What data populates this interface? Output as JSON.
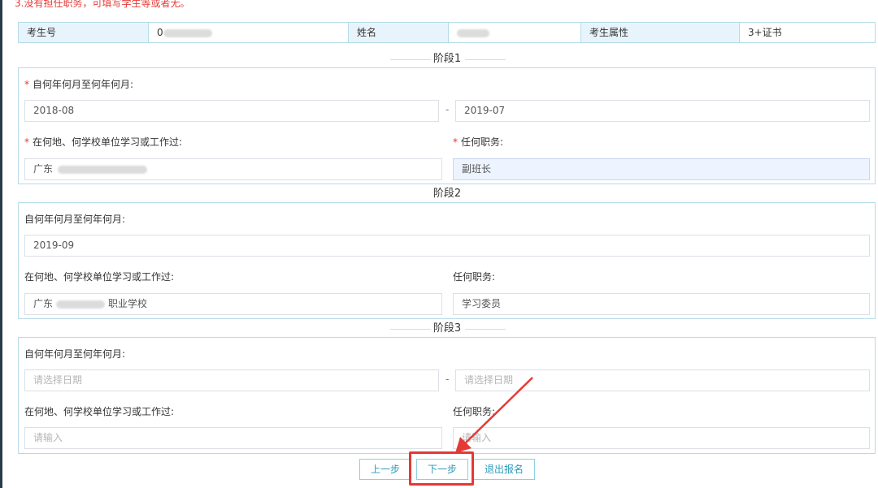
{
  "notice": "3.没有担任职务，可填写学生等或者无。",
  "info": {
    "exam_no_label": "考生号",
    "exam_no_value": "0",
    "name_label": "姓名",
    "attr_label": "考生属性",
    "attr_value": "3+证书"
  },
  "stages": [
    {
      "title": "阶段1",
      "period_label": "自何年何月至何年何月:",
      "from": "2018-08",
      "to": "2019-07",
      "place_label": "在何地、何学校单位学习或工作过:",
      "place": "广东",
      "role_label": "任何职务:",
      "role": "副班长"
    },
    {
      "title": "阶段2",
      "period_label": "自何年何月至何年何月:",
      "from": "2019-09",
      "place_label": "在何地、何学校单位学习或工作过:",
      "place_prefix": "广东",
      "place_suffix": "职业学校",
      "role_label": "任何职务:",
      "role": "学习委员"
    },
    {
      "title": "阶段3",
      "period_label": "自何年何月至何年何月:",
      "from_placeholder": "请选择日期",
      "to_placeholder": "请选择日期",
      "place_label": "在何地、何学校单位学习或工作过:",
      "place_placeholder": "请输入",
      "role_label": "任何职务:",
      "role_placeholder": "请输入"
    }
  ],
  "range_separator": "-",
  "buttons": {
    "prev": "上一步",
    "next": "下一步",
    "exit": "退出报名"
  },
  "colors": {
    "accent": "#2c9ab7",
    "border": "#b5dbe9",
    "required": "#e53935",
    "annotation": "#e53935"
  }
}
